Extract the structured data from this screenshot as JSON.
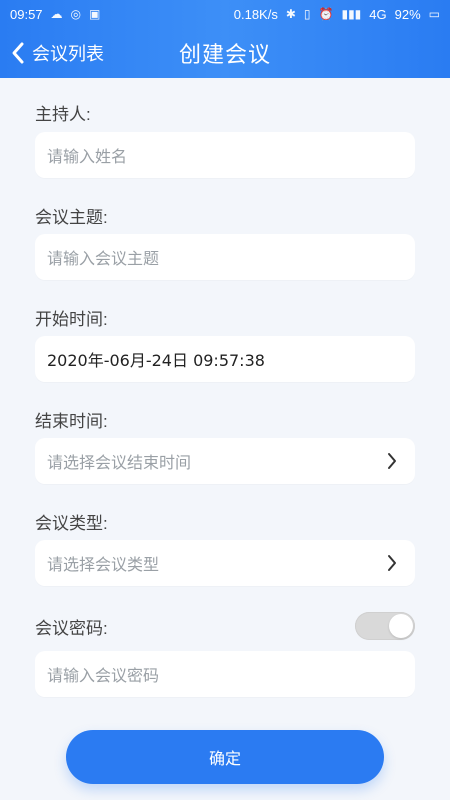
{
  "status_bar": {
    "time": "09:57",
    "speed": "0.18K/s",
    "network": "4G",
    "battery": "92%"
  },
  "nav": {
    "back_label": "会议列表",
    "title": "创建会议"
  },
  "form": {
    "host": {
      "label": "主持人:",
      "placeholder": "请输入姓名"
    },
    "topic": {
      "label": "会议主题:",
      "placeholder": "请输入会议主题"
    },
    "start_time": {
      "label": "开始时间:",
      "value": "2020年-06月-24日 09:57:38"
    },
    "end_time": {
      "label": "结束时间:",
      "placeholder": "请选择会议结束时间"
    },
    "type": {
      "label": "会议类型:",
      "placeholder": "请选择会议类型"
    },
    "password": {
      "label": "会议密码:",
      "placeholder": "请输入会议密码",
      "enabled": true
    }
  },
  "actions": {
    "confirm_label": "确定"
  },
  "colors": {
    "primary": "#2b7bf2",
    "background": "#f3f6fb"
  }
}
